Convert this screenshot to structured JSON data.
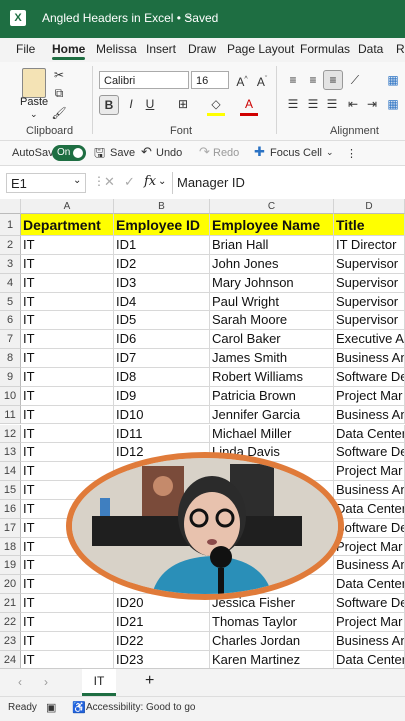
{
  "titlebar": {
    "title": "Angled Headers in Excel • Saved",
    "chevron": "chevron-down-icon"
  },
  "tabs": [
    "File",
    "Home",
    "Melissa",
    "Insert",
    "Draw",
    "Page Layout",
    "Formulas",
    "Data",
    "Re"
  ],
  "ribbon": {
    "paste_label": "Paste",
    "clipboard_label": "Clipboard",
    "font_label": "Font",
    "alignment_label": "Alignment",
    "font_name": "Calibri",
    "font_size": "16",
    "bold": "B",
    "italic": "I",
    "underline": "U"
  },
  "qat": {
    "autosave": "AutoSave",
    "toggle": "On",
    "save": "Save",
    "undo": "Undo",
    "redo": "Redo",
    "focus": "Focus Cell"
  },
  "formula": {
    "namebox": "E1",
    "fx": "fx",
    "content": "Manager ID"
  },
  "grid": {
    "columns": [
      "A",
      "B",
      "C",
      "D"
    ],
    "header_row": [
      "Department",
      "Employee ID",
      "Employee Name",
      "Title"
    ],
    "rows": [
      [
        "2",
        "IT",
        "ID1",
        "Brian Hall",
        "IT Director"
      ],
      [
        "3",
        "IT",
        "ID2",
        "John Jones",
        "Supervisor"
      ],
      [
        "4",
        "IT",
        "ID3",
        "Mary Johnson",
        "Supervisor"
      ],
      [
        "5",
        "IT",
        "ID4",
        "Paul Wright",
        "Supervisor"
      ],
      [
        "6",
        "IT",
        "ID5",
        "Sarah Moore",
        "Supervisor"
      ],
      [
        "7",
        "IT",
        "ID6",
        "Carol Baker",
        "Executive As"
      ],
      [
        "8",
        "IT",
        "ID7",
        "James Smith",
        "Business An"
      ],
      [
        "9",
        "IT",
        "ID8",
        "Robert Williams",
        "Software De"
      ],
      [
        "10",
        "IT",
        "ID9",
        "Patricia Brown",
        "Project Mar"
      ],
      [
        "11",
        "IT",
        "ID10",
        "Jennifer Garcia",
        "Business An"
      ],
      [
        "12",
        "IT",
        "ID11",
        "Michael Miller",
        "Data Center"
      ],
      [
        "13",
        "IT",
        "ID12",
        "Linda Davis",
        "Software De"
      ],
      [
        "14",
        "IT",
        "",
        "",
        "Project Mar"
      ],
      [
        "15",
        "IT",
        "",
        "",
        "Business An"
      ],
      [
        "16",
        "IT",
        "",
        "",
        "Data Center"
      ],
      [
        "17",
        "IT",
        "",
        "",
        "Software De"
      ],
      [
        "18",
        "IT",
        "",
        "",
        "Project Mar"
      ],
      [
        "19",
        "IT",
        "",
        "",
        "Business An"
      ],
      [
        "20",
        "IT",
        "",
        "",
        "Data Center"
      ],
      [
        "21",
        "IT",
        "ID20",
        "Jessica Fisher",
        "Software De"
      ],
      [
        "22",
        "IT",
        "ID21",
        "Thomas Taylor",
        "Project Mar"
      ],
      [
        "23",
        "IT",
        "ID22",
        "Charles Jordan",
        "Business An"
      ],
      [
        "24",
        "IT",
        "ID23",
        "Karen Martinez",
        "Data Center"
      ]
    ]
  },
  "sheet": {
    "tab": "IT",
    "add": "+"
  },
  "status": {
    "ready": "Ready",
    "accessibility": "Accessibility: Good to go"
  },
  "colors": {
    "brand": "#1e6e42",
    "highlight": "#ffff00",
    "overlay_ring": "#e07b3a"
  }
}
